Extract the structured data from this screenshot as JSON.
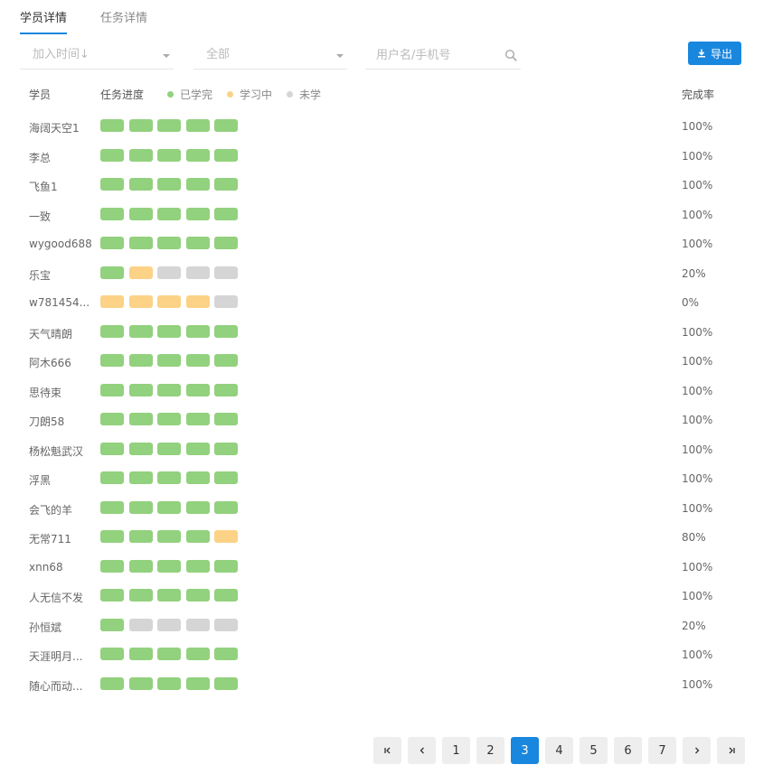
{
  "tabs": [
    {
      "label": "学员详情",
      "active": true
    },
    {
      "label": "任务详情",
      "active": false
    }
  ],
  "filters": {
    "join_time": "加入时间↓",
    "status": "全部",
    "search_placeholder": "用户名/手机号"
  },
  "export_label": "导出",
  "columns": {
    "student": "学员",
    "progress": "任务进度",
    "rate": "完成率"
  },
  "legend": [
    {
      "label": "已学完",
      "color": "#92d17d"
    },
    {
      "label": "学习中",
      "color": "#fcd286"
    },
    {
      "label": "未学",
      "color": "#d5d5d5"
    }
  ],
  "students": [
    {
      "name": "海阔天空1",
      "progress": [
        "done",
        "done",
        "done",
        "done",
        "done"
      ],
      "rate": "100%"
    },
    {
      "name": "李总",
      "progress": [
        "done",
        "done",
        "done",
        "done",
        "done"
      ],
      "rate": "100%"
    },
    {
      "name": "飞鱼1",
      "progress": [
        "done",
        "done",
        "done",
        "done",
        "done"
      ],
      "rate": "100%"
    },
    {
      "name": "一致",
      "progress": [
        "done",
        "done",
        "done",
        "done",
        "done"
      ],
      "rate": "100%"
    },
    {
      "name": "wygood688",
      "progress": [
        "done",
        "done",
        "done",
        "done",
        "done"
      ],
      "rate": "100%"
    },
    {
      "name": "乐宝",
      "progress": [
        "done",
        "learning",
        "none",
        "none",
        "none"
      ],
      "rate": "20%"
    },
    {
      "name": "w781454...",
      "progress": [
        "learning",
        "learning",
        "learning",
        "learning",
        "none"
      ],
      "rate": "0%"
    },
    {
      "name": "天气晴朗",
      "progress": [
        "done",
        "done",
        "done",
        "done",
        "done"
      ],
      "rate": "100%"
    },
    {
      "name": "阿木666",
      "progress": [
        "done",
        "done",
        "done",
        "done",
        "done"
      ],
      "rate": "100%"
    },
    {
      "name": "思待束",
      "progress": [
        "done",
        "done",
        "done",
        "done",
        "done"
      ],
      "rate": "100%"
    },
    {
      "name": "刀朗58",
      "progress": [
        "done",
        "done",
        "done",
        "done",
        "done"
      ],
      "rate": "100%"
    },
    {
      "name": "杨松魁武汉",
      "progress": [
        "done",
        "done",
        "done",
        "done",
        "done"
      ],
      "rate": "100%"
    },
    {
      "name": "浮黑",
      "progress": [
        "done",
        "done",
        "done",
        "done",
        "done"
      ],
      "rate": "100%"
    },
    {
      "name": "会飞的羊",
      "progress": [
        "done",
        "done",
        "done",
        "done",
        "done"
      ],
      "rate": "100%"
    },
    {
      "name": "无常711",
      "progress": [
        "done",
        "done",
        "done",
        "done",
        "learning"
      ],
      "rate": "80%"
    },
    {
      "name": "xnn68",
      "progress": [
        "done",
        "done",
        "done",
        "done",
        "done"
      ],
      "rate": "100%"
    },
    {
      "name": "人无信不发",
      "progress": [
        "done",
        "done",
        "done",
        "done",
        "done"
      ],
      "rate": "100%"
    },
    {
      "name": "孙恒斌",
      "progress": [
        "done",
        "none",
        "none",
        "none",
        "none"
      ],
      "rate": "20%"
    },
    {
      "name": "天涯明月...",
      "progress": [
        "done",
        "done",
        "done",
        "done",
        "done"
      ],
      "rate": "100%"
    },
    {
      "name": "随心而动...",
      "progress": [
        "done",
        "done",
        "done",
        "done",
        "done"
      ],
      "rate": "100%"
    }
  ],
  "pagination": {
    "pages": [
      "1",
      "2",
      "3",
      "4",
      "5",
      "6",
      "7"
    ],
    "current": "3"
  },
  "colors": {
    "accent": "#1a87de",
    "done": "#92d17d",
    "learning": "#fcd286",
    "none": "#d5d5d5"
  }
}
